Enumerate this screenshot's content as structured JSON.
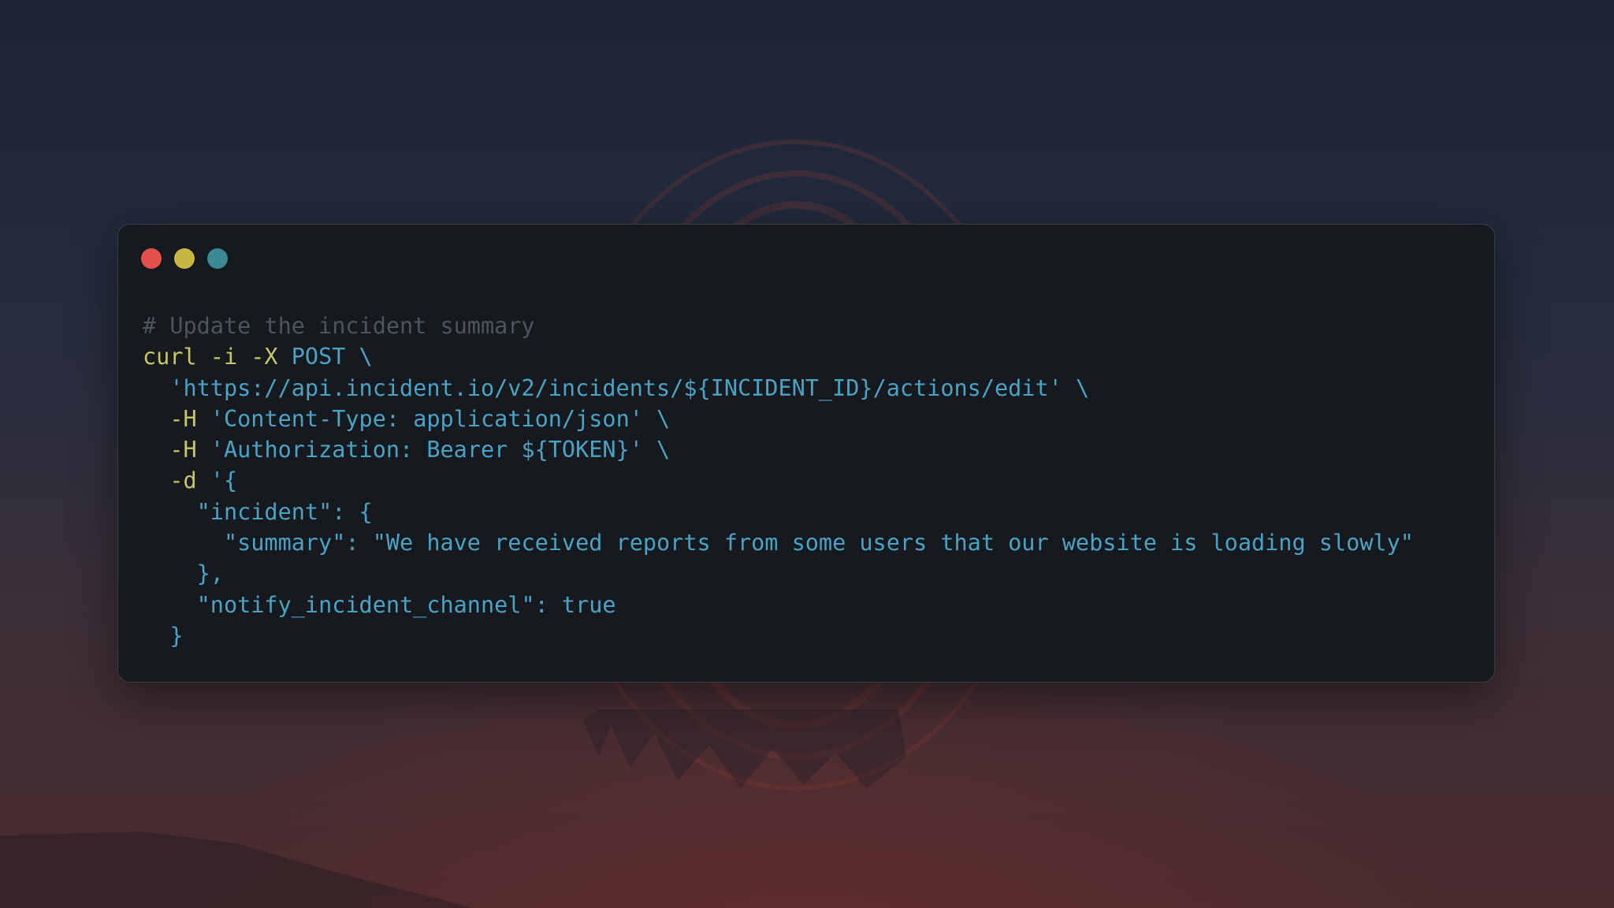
{
  "colors": {
    "close_dot": "#e2524a",
    "minimize_dot": "#c7b545",
    "maximize_dot": "#3b8794",
    "comment": "#4b5560",
    "command": "#c8c765",
    "string": "#4aa3c7",
    "window_bg": "#16191d"
  },
  "window": {
    "controls": [
      {
        "name": "close-dot",
        "icon": "red-circle"
      },
      {
        "name": "minimize-dot",
        "icon": "yellow-circle"
      },
      {
        "name": "maximize-dot",
        "icon": "teal-circle"
      }
    ]
  },
  "code": {
    "lines": [
      {
        "indent": "",
        "tokens": [
          {
            "cls": "tok-comment",
            "text": "# Update the incident summary"
          }
        ]
      },
      {
        "indent": "",
        "tokens": [
          {
            "cls": "tok-cmd",
            "text": "curl -i -X "
          },
          {
            "cls": "tok-str",
            "text": "POST \\"
          }
        ]
      },
      {
        "indent": "  ",
        "tokens": [
          {
            "cls": "tok-str",
            "text": "'https://api.incident.io/v2/incidents/${INCIDENT_ID}/actions/edit' \\"
          }
        ]
      },
      {
        "indent": "  ",
        "tokens": [
          {
            "cls": "tok-flag",
            "text": "-H "
          },
          {
            "cls": "tok-str",
            "text": "'Content-Type: application/json' \\"
          }
        ]
      },
      {
        "indent": "  ",
        "tokens": [
          {
            "cls": "tok-flag",
            "text": "-H "
          },
          {
            "cls": "tok-str",
            "text": "'Authorization: Bearer ${TOKEN}' \\"
          }
        ]
      },
      {
        "indent": "  ",
        "tokens": [
          {
            "cls": "tok-flag",
            "text": "-d "
          },
          {
            "cls": "tok-str",
            "text": "'{"
          }
        ]
      },
      {
        "indent": "    ",
        "tokens": [
          {
            "cls": "tok-str",
            "text": "\"incident\": {"
          }
        ]
      },
      {
        "indent": "      ",
        "tokens": [
          {
            "cls": "tok-str",
            "text": "\"summary\": \"We have received reports from some users that our website is loading slowly\""
          }
        ]
      },
      {
        "indent": "    ",
        "tokens": [
          {
            "cls": "tok-str",
            "text": "},"
          }
        ]
      },
      {
        "indent": "    ",
        "tokens": [
          {
            "cls": "tok-str",
            "text": "\"notify_incident_channel\": true"
          }
        ]
      },
      {
        "indent": "  ",
        "tokens": [
          {
            "cls": "tok-str",
            "text": "}"
          }
        ]
      }
    ]
  }
}
